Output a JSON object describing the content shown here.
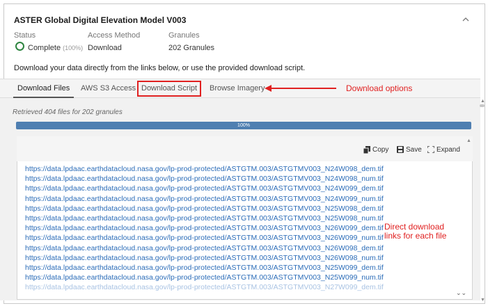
{
  "collection": {
    "title": "ASTER Global Digital Elevation Model V003",
    "status_label": "Status",
    "status_value": "Complete",
    "status_pct": "(100%)",
    "access_label": "Access Method",
    "access_value": "Download",
    "granules_label": "Granules",
    "granules_value": "202 Granules",
    "description": "Download your data directly from the links below, or use the provided download script."
  },
  "tabs": [
    {
      "label": "Download Files",
      "active": true
    },
    {
      "label": "AWS S3 Access",
      "active": false
    },
    {
      "label": "Download Script",
      "active": false
    },
    {
      "label": "Browse Imagery",
      "active": false
    }
  ],
  "annotations": {
    "download_options": "Download options",
    "direct_links_line1": "Direct download",
    "direct_links_line2": "links for each file"
  },
  "retrieved_text": "Retrieved 404 files for 202 granules",
  "progress": {
    "value": 100,
    "label": "100%"
  },
  "toolbar": {
    "copy": "Copy",
    "save": "Save",
    "expand": "Expand"
  },
  "links": [
    "https://data.lpdaac.earthdatacloud.nasa.gov/lp-prod-protected/ASTGTM.003/ASTGTMV003_N24W098_dem.tif",
    "https://data.lpdaac.earthdatacloud.nasa.gov/lp-prod-protected/ASTGTM.003/ASTGTMV003_N24W098_num.tif",
    "https://data.lpdaac.earthdatacloud.nasa.gov/lp-prod-protected/ASTGTM.003/ASTGTMV003_N24W099_dem.tif",
    "https://data.lpdaac.earthdatacloud.nasa.gov/lp-prod-protected/ASTGTM.003/ASTGTMV003_N24W099_num.tif",
    "https://data.lpdaac.earthdatacloud.nasa.gov/lp-prod-protected/ASTGTM.003/ASTGTMV003_N25W098_dem.tif",
    "https://data.lpdaac.earthdatacloud.nasa.gov/lp-prod-protected/ASTGTM.003/ASTGTMV003_N25W098_num.tif",
    "https://data.lpdaac.earthdatacloud.nasa.gov/lp-prod-protected/ASTGTM.003/ASTGTMV003_N26W099_dem.tif",
    "https://data.lpdaac.earthdatacloud.nasa.gov/lp-prod-protected/ASTGTM.003/ASTGTMV003_N26W099_num.tif",
    "https://data.lpdaac.earthdatacloud.nasa.gov/lp-prod-protected/ASTGTM.003/ASTGTMV003_N26W098_dem.tif",
    "https://data.lpdaac.earthdatacloud.nasa.gov/lp-prod-protected/ASTGTM.003/ASTGTMV003_N26W098_num.tif",
    "https://data.lpdaac.earthdatacloud.nasa.gov/lp-prod-protected/ASTGTM.003/ASTGTMV003_N25W099_dem.tif",
    "https://data.lpdaac.earthdatacloud.nasa.gov/lp-prod-protected/ASTGTM.003/ASTGTMV003_N25W099_num.tif",
    "https://data.lpdaac.earthdatacloud.nasa.gov/lp-prod-protected/ASTGTM.003/ASTGTMV003_N27W099_dem.tif"
  ],
  "colors": {
    "accent": "#4f7fb1",
    "link": "#2b6cb8",
    "annotation": "#e02020",
    "success": "#2e8540"
  },
  "icons": [
    "chevron-up-icon",
    "status-circle-icon",
    "copy-icon",
    "save-icon",
    "expand-icon",
    "arrow-left-icon",
    "chevron-double-down-icon"
  ]
}
